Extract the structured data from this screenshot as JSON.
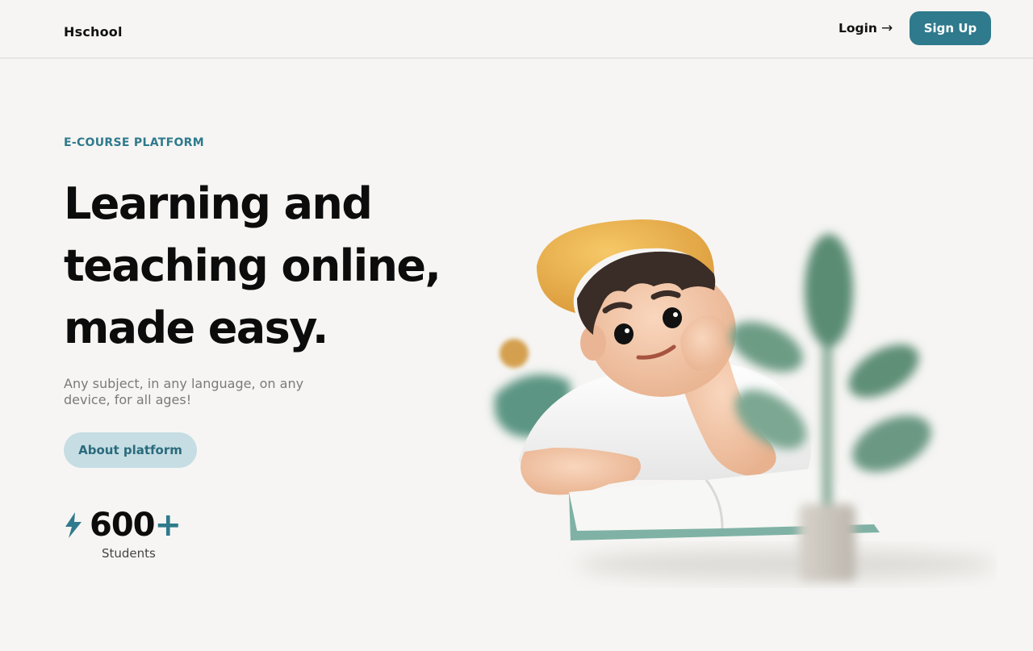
{
  "nav": {
    "logo": "Hschool",
    "login_label": "Login",
    "login_arrow": "→",
    "signup_label": "Sign Up"
  },
  "hero": {
    "eyebrow": "E-COURSE PLATFORM",
    "headline_lines": [
      "Learning and",
      "teaching online,",
      "made easy."
    ],
    "subtext": "Any subject, in any language, on any device, for all ages!",
    "cta_label": "About platform",
    "stat_value": "600",
    "stat_suffix": "+",
    "stat_label": "Students",
    "stat_icon": "lightning-bolt-icon",
    "illustration": "boy-reading-book-illustration"
  },
  "colors": {
    "accent": "#2f7a8c",
    "accent_soft": "#c5dde3",
    "background": "#f6f5f3",
    "cap": "#e8b04b",
    "plant": "#5d8a73"
  }
}
